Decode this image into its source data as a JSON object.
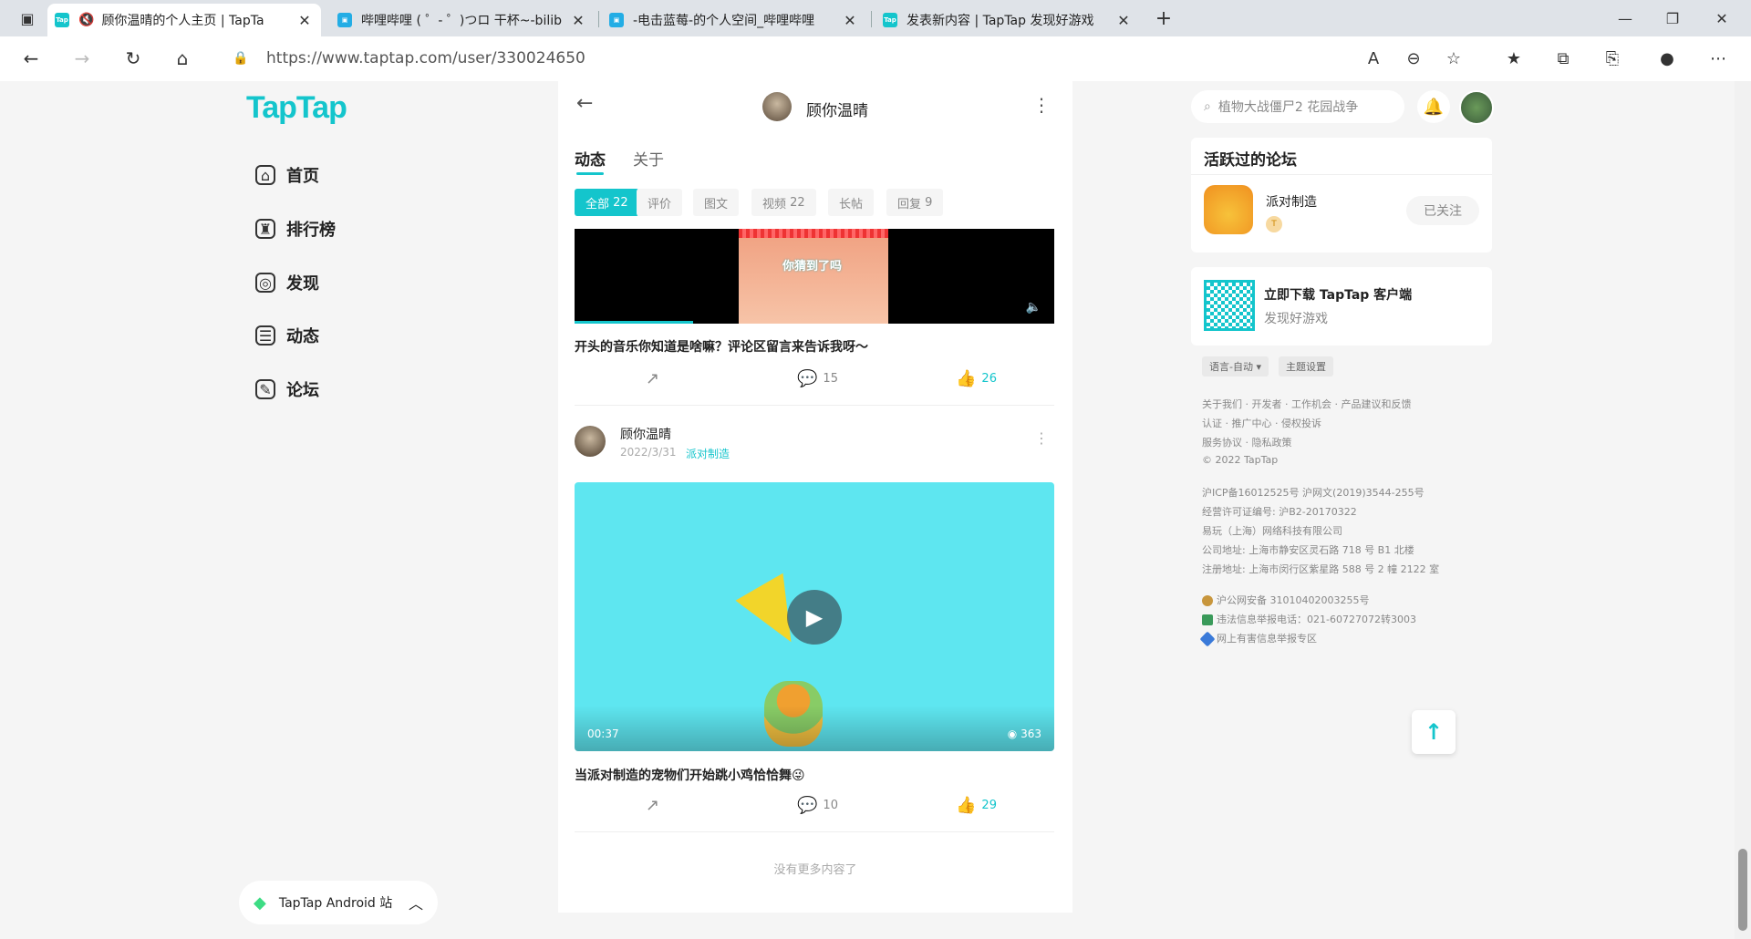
{
  "browser": {
    "tabs": [
      {
        "title": "顾你温晴的个人主页 | TapTa",
        "icon": "taptap-icon",
        "icon_label": "Tap",
        "muted": true
      },
      {
        "title": "哔哩哔哩 ( ゜- ゜)つロ 干杯~-bilib",
        "icon": "bilibili-icon",
        "icon_label": "▣"
      },
      {
        "title": "-电击蓝莓-的个人空间_哔哩哔哩",
        "icon": "bilibili-icon",
        "icon_label": "▣"
      },
      {
        "title": "发表新内容 | TapTap 发现好游戏",
        "icon": "taptap-icon",
        "icon_label": "Tap"
      }
    ],
    "url": "https://www.taptap.com/user/330024650",
    "colors": {
      "tab_bg": "#dfe3e8",
      "taptap": "#14c5cc",
      "bilibili": "#23ade5"
    }
  },
  "sidebar": {
    "logo": "TapTap",
    "items": [
      {
        "label": "首页",
        "icon": "home-icon"
      },
      {
        "label": "排行榜",
        "icon": "trophy-icon"
      },
      {
        "label": "发现",
        "icon": "discover-icon"
      },
      {
        "label": "动态",
        "icon": "feed-icon"
      },
      {
        "label": "论坛",
        "icon": "forum-icon"
      }
    ],
    "android_label": "TapTap Android 站"
  },
  "profile": {
    "name": "顾你温晴",
    "tabs": [
      "动态",
      "关于"
    ],
    "filters": [
      {
        "label": "全部",
        "count": "22",
        "active": true
      },
      {
        "label": "评价",
        "count": ""
      },
      {
        "label": "图文",
        "count": ""
      },
      {
        "label": "视频",
        "count": "22"
      },
      {
        "label": "长帖",
        "count": ""
      },
      {
        "label": "回复",
        "count": "9"
      }
    ]
  },
  "posts": [
    {
      "video_text": "你猜到了吗",
      "title": "开头的音乐你知道是啥嘛？评论区留言来告诉我呀～",
      "comments": "15",
      "likes": "26"
    },
    {
      "author": "顾你温晴",
      "date": "2022/3/31",
      "forum": "派对制造",
      "duration": "00:37",
      "views": "363",
      "title": "当派对制造的宠物们开始跳小鸡恰恰舞😜",
      "comments": "10",
      "likes": "29"
    }
  ],
  "no_more": "没有更多内容了",
  "right": {
    "search_placeholder": "植物大战僵尸2 花园战争",
    "forum_heading": "活跃过的论坛",
    "forum_name": "派对制造",
    "forum_badge": "T",
    "forum_button": "已关注",
    "download_title": "立即下载 TapTap 客户端",
    "download_sub": "发现好游戏",
    "lang_pill": "语言-自动 ▾",
    "theme_pill": "主题设置",
    "footer_links": [
      "关于我们 · 开发者 · 工作机会 · 产品建议和反馈",
      "认证 · 推广中心 · 侵权投诉",
      "服务协议 · 隐私政策",
      "© 2022 TapTap"
    ],
    "legal": [
      "沪ICP备16012525号    沪网文(2019)3544-255号",
      "经营许可证编号: 沪B2-20170322",
      "易玩（上海）网络科技有限公司",
      "公司地址: 上海市静安区灵石路 718 号 B1 北楼",
      "注册地址: 上海市闵行区紫星路 588 号 2 幢 2122 室"
    ],
    "badges": [
      "沪公网安备 31010402003255号",
      "违法信息举报电话：021-60727072转3003",
      "网上有害信息举报专区"
    ]
  }
}
